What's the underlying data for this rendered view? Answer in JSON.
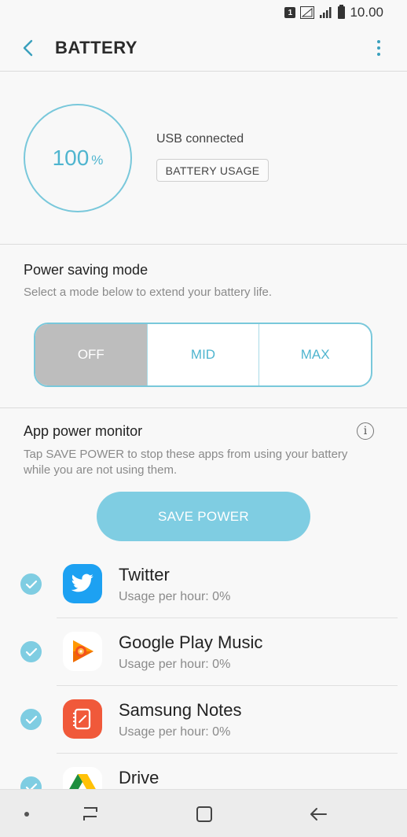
{
  "status_bar": {
    "sim": "1",
    "time": "10.00"
  },
  "header": {
    "title": "BATTERY"
  },
  "battery": {
    "level": "100",
    "unit": "%",
    "status": "USB connected",
    "usage_button": "BATTERY USAGE"
  },
  "power_saving": {
    "title": "Power saving mode",
    "description": "Select a mode below to extend your battery life.",
    "modes": [
      "OFF",
      "MID",
      "MAX"
    ],
    "selected": "OFF"
  },
  "app_monitor": {
    "title": "App power monitor",
    "description_line1": "Tap SAVE POWER to stop these apps from using your battery",
    "description_line2": "while you are not using them.",
    "save_button": "SAVE POWER",
    "apps": [
      {
        "name": "Twitter",
        "usage": "Usage per hour: 0%",
        "checked": true
      },
      {
        "name": "Google Play Music",
        "usage": "Usage per hour: 0%",
        "checked": true
      },
      {
        "name": "Samsung Notes",
        "usage": "Usage per hour: 0%",
        "checked": true
      },
      {
        "name": "Drive",
        "usage": "",
        "checked": true
      }
    ]
  },
  "colors": {
    "accent": "#4fb5cf",
    "accent_light": "#7fcde2",
    "twitter": "#1da1f2",
    "notes": "#f0593a"
  },
  "icons": {
    "back": "chevron-left-icon",
    "more": "more-vertical-icon",
    "info": "info-icon",
    "check": "check-icon",
    "nav_recent": "recent-apps-icon",
    "nav_home": "home-icon",
    "nav_back": "back-arrow-icon"
  }
}
